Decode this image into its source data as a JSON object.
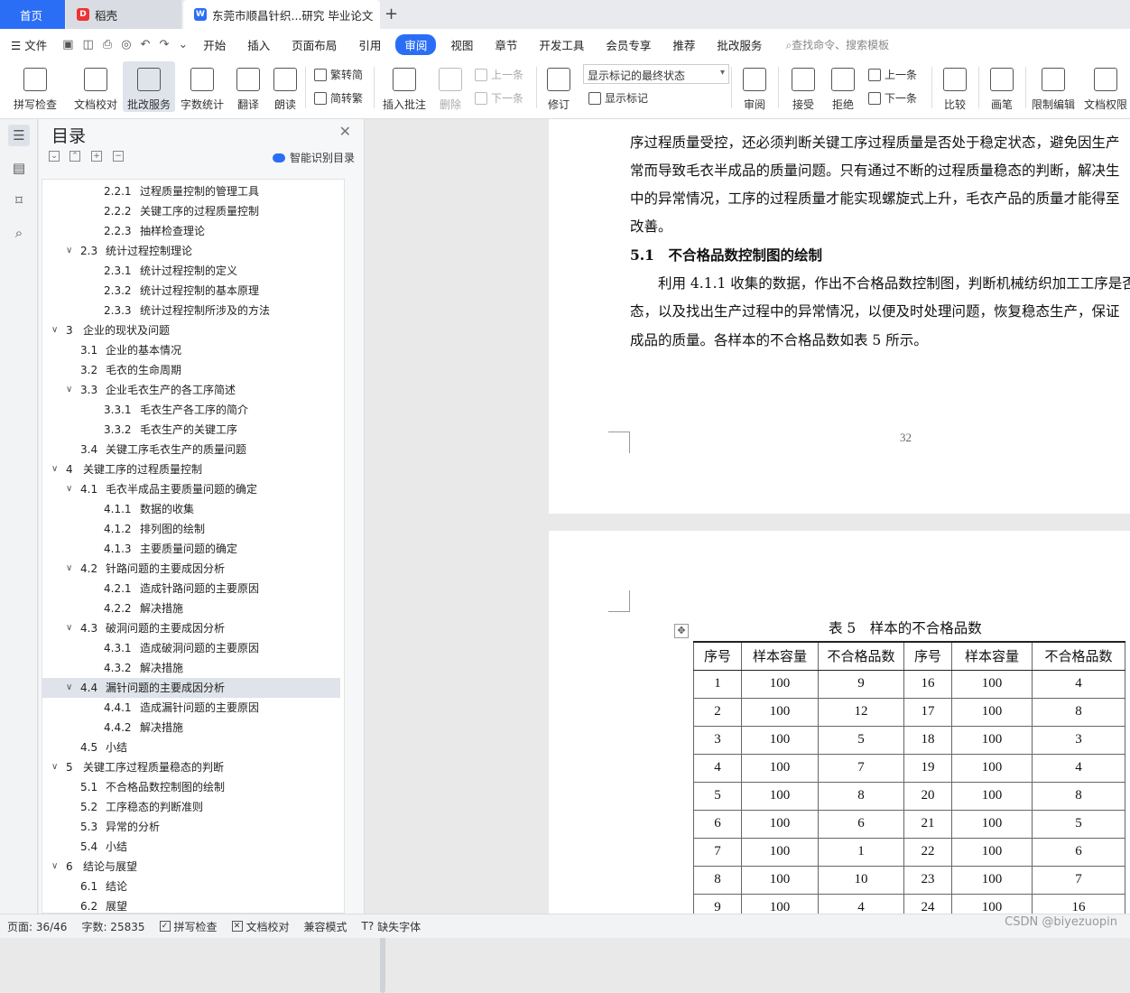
{
  "tabs": {
    "home": "首页",
    "daoke": "稻壳",
    "doc": "东莞市顺昌针织...研究 毕业论文"
  },
  "menu": {
    "file": "文件",
    "items": [
      "开始",
      "插入",
      "页面布局",
      "引用",
      "审阅",
      "视图",
      "章节",
      "开发工具",
      "会员专享",
      "推荐",
      "批改服务"
    ],
    "active": "审阅",
    "search_placeholder": "查找命令、搜索模板"
  },
  "ribbon": {
    "spell_check": "拼写检查",
    "doc_proof": "文档校对",
    "correction_service": "批改服务",
    "word_count": "字数统计",
    "translate": "翻译",
    "read_aloud": "朗读",
    "trad_conv": "繁转简",
    "simp_conv": "简转繁",
    "insert_comment": "插入批注",
    "delete": "删除",
    "prev": "上一条",
    "next": "下一条",
    "revise": "修订",
    "status_select": "显示标记的最终状态",
    "show_marks": "显示标记",
    "review": "审阅",
    "accept": "接受",
    "reject": "拒绝",
    "prev2": "上一条",
    "next2": "下一条",
    "compare": "比较",
    "pen": "画笔",
    "restrict_edit": "限制编辑",
    "doc_perm": "文档权限"
  },
  "toc": {
    "title": "目录",
    "smart": "智能识别目录",
    "items": [
      {
        "num": "2.2.1",
        "text": "过程质量控制的管理工具",
        "level": 3
      },
      {
        "num": "2.2.2",
        "text": "关键工序的过程质量控制",
        "level": 3
      },
      {
        "num": "2.2.3",
        "text": "抽样检查理论",
        "level": 3
      },
      {
        "num": "2.3",
        "text": "统计过程控制理论",
        "level": 2
      },
      {
        "num": "2.3.1",
        "text": "统计过程控制的定义",
        "level": 3
      },
      {
        "num": "2.3.2",
        "text": "统计过程控制的基本原理",
        "level": 3
      },
      {
        "num": "2.3.3",
        "text": "统计过程控制所涉及的方法",
        "level": 3
      },
      {
        "num": "3",
        "text": "企业的现状及问题",
        "level": 1
      },
      {
        "num": "3.1",
        "text": "企业的基本情况",
        "level": 2
      },
      {
        "num": "3.2",
        "text": "毛衣的生命周期",
        "level": 2
      },
      {
        "num": "3.3",
        "text": "企业毛衣生产的各工序简述",
        "level": 2
      },
      {
        "num": "3.3.1",
        "text": "毛衣生产各工序的简介",
        "level": 3
      },
      {
        "num": "3.3.2",
        "text": "毛衣生产的关键工序",
        "level": 3
      },
      {
        "num": "3.4",
        "text": "关键工序毛衣生产的质量问题",
        "level": 2
      },
      {
        "num": "4",
        "text": "关键工序的过程质量控制",
        "level": 1
      },
      {
        "num": "4.1",
        "text": "毛衣半成品主要质量问题的确定",
        "level": 2
      },
      {
        "num": "4.1.1",
        "text": "数据的收集",
        "level": 3
      },
      {
        "num": "4.1.2",
        "text": "排列图的绘制",
        "level": 3
      },
      {
        "num": "4.1.3",
        "text": "主要质量问题的确定",
        "level": 3
      },
      {
        "num": "4.2",
        "text": "针路问题的主要成因分析",
        "level": 2
      },
      {
        "num": "4.2.1",
        "text": "造成针路问题的主要原因",
        "level": 3
      },
      {
        "num": "4.2.2",
        "text": "解决措施",
        "level": 3
      },
      {
        "num": "4.3",
        "text": "破洞问题的主要成因分析",
        "level": 2
      },
      {
        "num": "4.3.1",
        "text": "造成破洞问题的主要原因",
        "level": 3
      },
      {
        "num": "4.3.2",
        "text": "解决措施",
        "level": 3
      },
      {
        "num": "4.4",
        "text": "漏针问题的主要成因分析",
        "level": 2
      },
      {
        "num": "4.4.1",
        "text": "造成漏针问题的主要原因",
        "level": 3
      },
      {
        "num": "4.4.2",
        "text": "解决措施",
        "level": 3
      },
      {
        "num": "4.5",
        "text": "小结",
        "level": 2
      },
      {
        "num": "5",
        "text": "关键工序过程质量稳态的判断",
        "level": 1
      },
      {
        "num": "5.1",
        "text": "不合格品数控制图的绘制",
        "level": 2
      },
      {
        "num": "5.2",
        "text": "工序稳态的判断准则",
        "level": 2
      },
      {
        "num": "5.3",
        "text": "异常的分析",
        "level": 2
      },
      {
        "num": "5.4",
        "text": "小结",
        "level": 2
      },
      {
        "num": "6",
        "text": "结论与展望",
        "level": 1
      },
      {
        "num": "6.1",
        "text": "结论",
        "level": 2
      },
      {
        "num": "6.2",
        "text": "展望",
        "level": 2
      }
    ],
    "selected_num": "4.4"
  },
  "doc": {
    "p1_lines": [
      "序过程质量受控，还必须判断关键工序过程质量是否处于稳定状态，避免因生产",
      "常而导致毛衣半成品的质量问题。只有通过不断的过程质量稳态的判断，解决生",
      "中的异常情况，工序的过程质量才能实现螺旋式上升，毛衣产品的质量才能得至",
      "改善。"
    ],
    "heading": "5.1　不合格品数控制图的绘制",
    "p2_lines": [
      "　　利用 4.1.1 收集的数据，作出不合格品数控制图，判断机械纺织加工工序是否",
      "态，以及找出生产过程中的异常情况，以便及时处理问题，恢复稳态生产，保证",
      "成品的质量。各样本的不合格品数如表 5 所示。"
    ],
    "page_number": "32",
    "table_caption": "表 5　样本的不合格品数",
    "table_headers": [
      "序号",
      "样本容量",
      "不合格品数",
      "序号",
      "样本容量",
      "不合格品数"
    ],
    "table_rows": [
      [
        "1",
        "100",
        "9",
        "16",
        "100",
        "4"
      ],
      [
        "2",
        "100",
        "12",
        "17",
        "100",
        "8"
      ],
      [
        "3",
        "100",
        "5",
        "18",
        "100",
        "3"
      ],
      [
        "4",
        "100",
        "7",
        "19",
        "100",
        "4"
      ],
      [
        "5",
        "100",
        "8",
        "20",
        "100",
        "8"
      ],
      [
        "6",
        "100",
        "6",
        "21",
        "100",
        "5"
      ],
      [
        "7",
        "100",
        "1",
        "22",
        "100",
        "6"
      ],
      [
        "8",
        "100",
        "10",
        "23",
        "100",
        "7"
      ],
      [
        "9",
        "100",
        "4",
        "24",
        "100",
        "16"
      ]
    ]
  },
  "status": {
    "page": "页面: 36/46",
    "words": "字数: 25835",
    "spell": "拼写检查",
    "proof": "文档校对",
    "compat": "兼容模式",
    "missing_font": "缺失字体"
  },
  "watermark": "CSDN @biyezuopin",
  "colors": {
    "accent": "#2b6ef6",
    "selected": "#dfe3ea"
  }
}
